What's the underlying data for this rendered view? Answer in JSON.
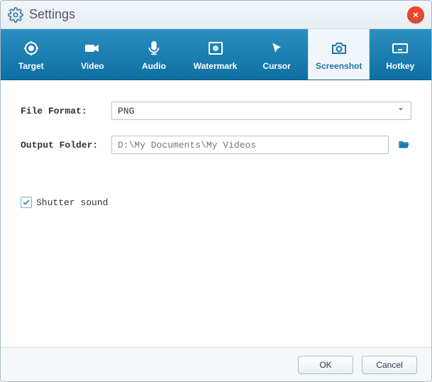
{
  "window": {
    "title": "Settings"
  },
  "tabs": {
    "items": [
      {
        "label": "Target"
      },
      {
        "label": "Video"
      },
      {
        "label": "Audio"
      },
      {
        "label": "Watermark"
      },
      {
        "label": "Cursor"
      },
      {
        "label": "Screenshot"
      },
      {
        "label": "Hotkey"
      }
    ],
    "active_index": 5
  },
  "form": {
    "file_format": {
      "label": "File Format:",
      "value": "PNG"
    },
    "output_folder": {
      "label": "Output Folder:",
      "value": "D:\\My Documents\\My Videos"
    },
    "shutter_sound": {
      "label": "Shutter sound",
      "checked": true
    }
  },
  "buttons": {
    "ok": "OK",
    "cancel": "Cancel"
  }
}
